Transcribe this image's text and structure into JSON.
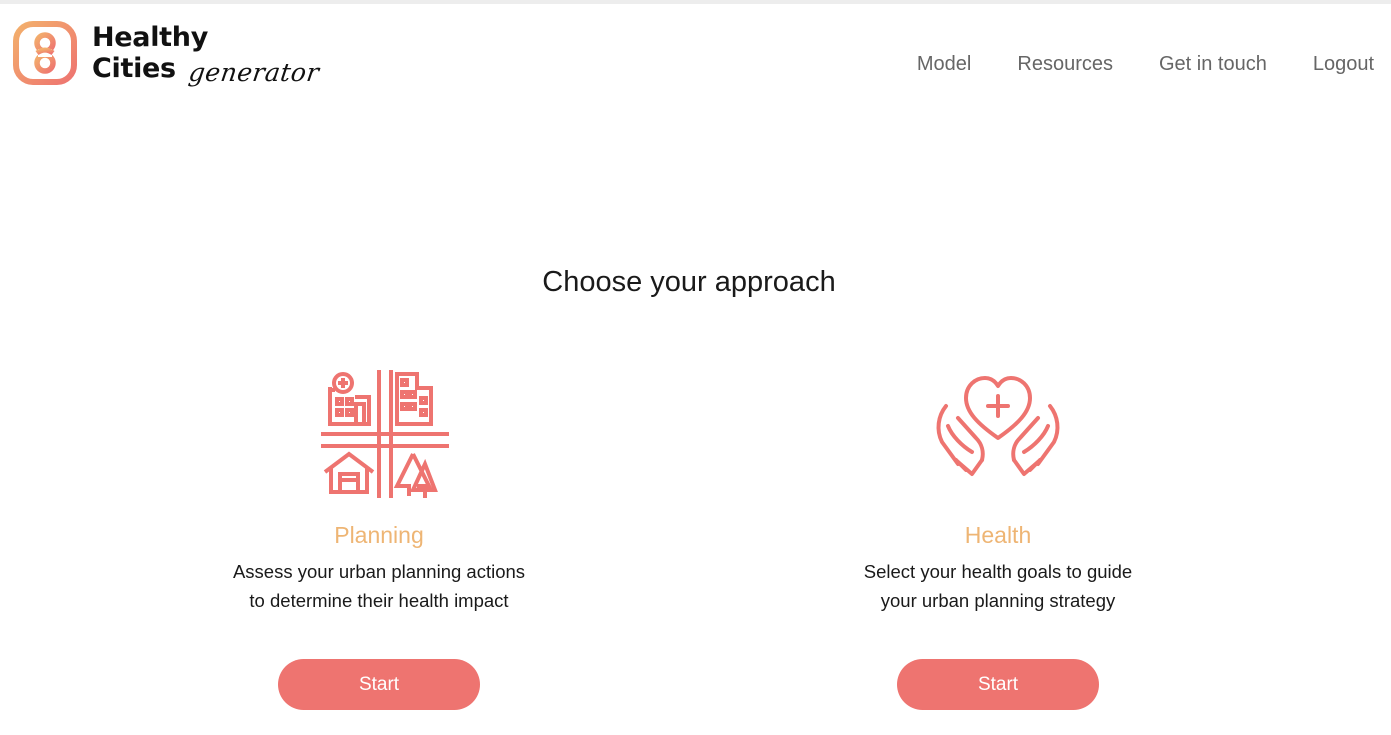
{
  "brand": {
    "line1": "Healthy",
    "line2": "Cities",
    "script": "generator",
    "logo_icon": "interlocking-loops-logo",
    "gradient": [
      "#f3b06c",
      "#ee7470"
    ]
  },
  "nav": {
    "items": [
      {
        "label": "Model"
      },
      {
        "label": "Resources"
      },
      {
        "label": "Get in touch"
      },
      {
        "label": "Logout"
      }
    ]
  },
  "main": {
    "heading": "Choose your approach",
    "cards": [
      {
        "icon": "city-planning-icon",
        "title": "Planning",
        "desc_line1": "Assess your urban planning actions",
        "desc_line2": "to determine their health impact",
        "button_label": "Start"
      },
      {
        "icon": "hands-heart-icon",
        "title": "Health",
        "desc_line1": "Select your health goals to guide",
        "desc_line2": "your urban planning strategy",
        "button_label": "Start"
      }
    ]
  },
  "colors": {
    "accent": "#ee7470",
    "title": "#eeb574",
    "nav_text": "#666666",
    "icon_stroke": "#ee7470"
  }
}
